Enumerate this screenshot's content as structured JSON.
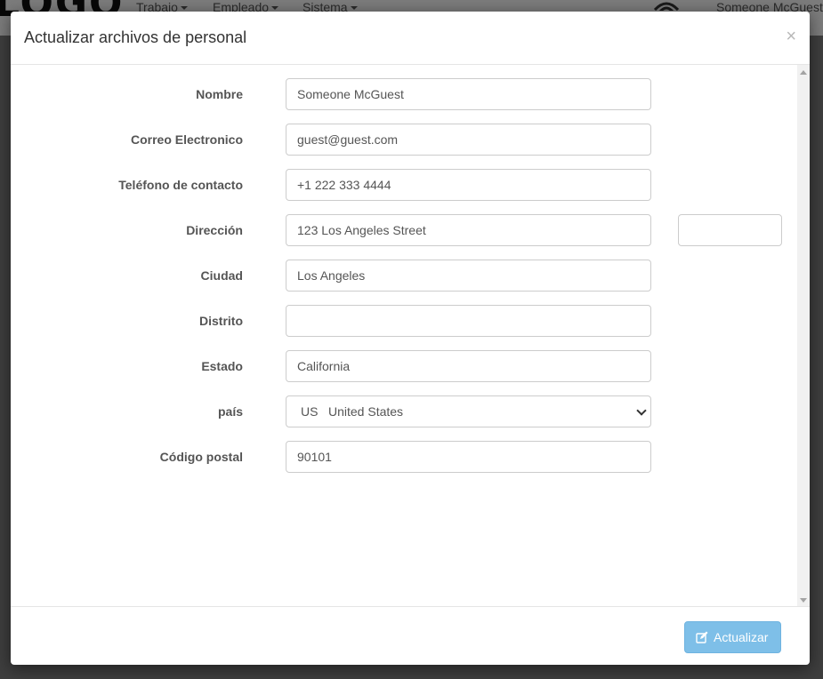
{
  "background": {
    "logo": "LOGO",
    "menu": [
      "Trabajo",
      "Empleado",
      "Sistema"
    ],
    "user": "Someone McGuest"
  },
  "modal": {
    "title": "Actualizar archivos de personal",
    "close": "×",
    "fields": [
      {
        "label": "Nombre",
        "value": "Someone McGuest"
      },
      {
        "label": "Correo Electronico",
        "value": "guest@guest.com"
      },
      {
        "label": "Teléfono de contacto",
        "value": "+1 222 333 4444"
      },
      {
        "label": "Dirección",
        "value": "123 Los Angeles Street",
        "extra_value": ""
      },
      {
        "label": "Ciudad",
        "value": "Los Angeles"
      },
      {
        "label": "Distrito",
        "value": ""
      },
      {
        "label": "Estado",
        "value": "California"
      },
      {
        "label": "país",
        "select_code": "US",
        "select_name": "United States"
      },
      {
        "label": "Código postal",
        "value": "90101"
      }
    ],
    "submit_label": "Actualizar"
  },
  "colors": {
    "primary_button": "#7ebfe8",
    "backdrop": "rgba(0,0,0,0.5)"
  }
}
